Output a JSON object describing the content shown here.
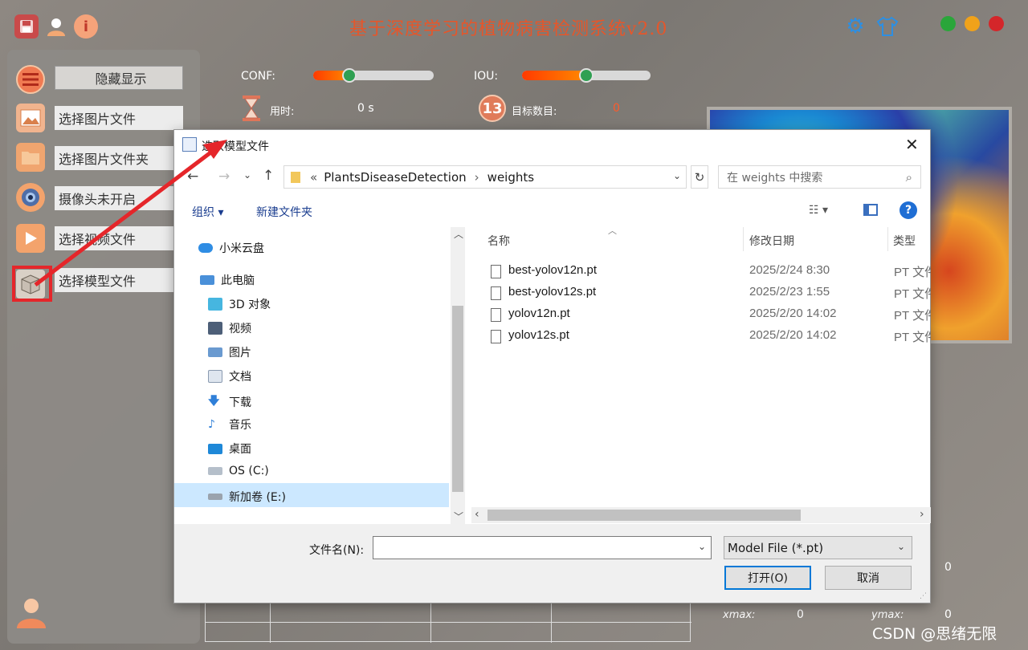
{
  "app": {
    "title": "基于深度学习的植物病害检测系统v2.0",
    "window_dots": {
      "green": "#2aa63a",
      "yellow": "#f0a21a",
      "red": "#d4262a"
    }
  },
  "sidebar": {
    "items": [
      {
        "label": "隐藏显示",
        "icon": "menu-icon"
      },
      {
        "label": "选择图片文件",
        "icon": "image-icon"
      },
      {
        "label": "选择图片文件夹",
        "icon": "folder-icon"
      },
      {
        "label": "摄像头未开启",
        "icon": "camera-icon"
      },
      {
        "label": "选择视频文件",
        "icon": "video-play-icon"
      },
      {
        "label": "选择模型文件",
        "icon": "model-box-icon"
      }
    ]
  },
  "controls": {
    "conf_label": "CONF:",
    "conf_value": 0.3,
    "iou_label": "IOU:",
    "iou_value": 0.5,
    "time_label": "用时:",
    "time_value": "0 s",
    "count_label": "目标数目:",
    "count_value": "0",
    "count_badge": "13"
  },
  "coords": {
    "xmax_label": "xmax:",
    "xmax_value": "0",
    "ymax_label": "ymax:",
    "ymax_value": "0",
    "extra_value": "0"
  },
  "watermark": "CSDN @思绪无限",
  "dialog": {
    "title": "选取模型文件",
    "breadcrumb": [
      "PlantsDiseaseDetection",
      "weights"
    ],
    "search_placeholder": "在 weights 中搜索",
    "toolbar": {
      "organize": "组织",
      "new_folder": "新建文件夹"
    },
    "nav_tree": [
      {
        "label": "小米云盘",
        "icon": "cloud-icon",
        "indent": 0
      },
      {
        "label": "此电脑",
        "icon": "computer-icon",
        "indent": 0
      },
      {
        "label": "3D 对象",
        "icon": "cube-3d-icon",
        "indent": 1
      },
      {
        "label": "视频",
        "icon": "film-icon",
        "indent": 1
      },
      {
        "label": "图片",
        "icon": "picture-icon",
        "indent": 1
      },
      {
        "label": "文档",
        "icon": "document-icon",
        "indent": 1
      },
      {
        "label": "下载",
        "icon": "download-arrow-icon",
        "indent": 1
      },
      {
        "label": "音乐",
        "icon": "music-note-icon",
        "indent": 1
      },
      {
        "label": "桌面",
        "icon": "desktop-icon",
        "indent": 1
      },
      {
        "label": "OS (C:)",
        "icon": "drive-windows-icon",
        "indent": 1
      },
      {
        "label": "新加卷 (E:)",
        "icon": "drive-icon",
        "indent": 1,
        "selected": true
      }
    ],
    "columns": [
      "名称",
      "修改日期",
      "类型"
    ],
    "files": [
      {
        "name": "best-yolov12n.pt",
        "date": "2025/2/24 8:30",
        "type": "PT 文件"
      },
      {
        "name": "best-yolov12s.pt",
        "date": "2025/2/23 1:55",
        "type": "PT 文件"
      },
      {
        "name": "yolov12n.pt",
        "date": "2025/2/20 14:02",
        "type": "PT 文件"
      },
      {
        "name": "yolov12s.pt",
        "date": "2025/2/20 14:02",
        "type": "PT 文件"
      }
    ],
    "filename_label": "文件名(N):",
    "filename_value": "",
    "filter_value": "Model File (*.pt)",
    "open_button": "打开(O)",
    "cancel_button": "取消"
  }
}
